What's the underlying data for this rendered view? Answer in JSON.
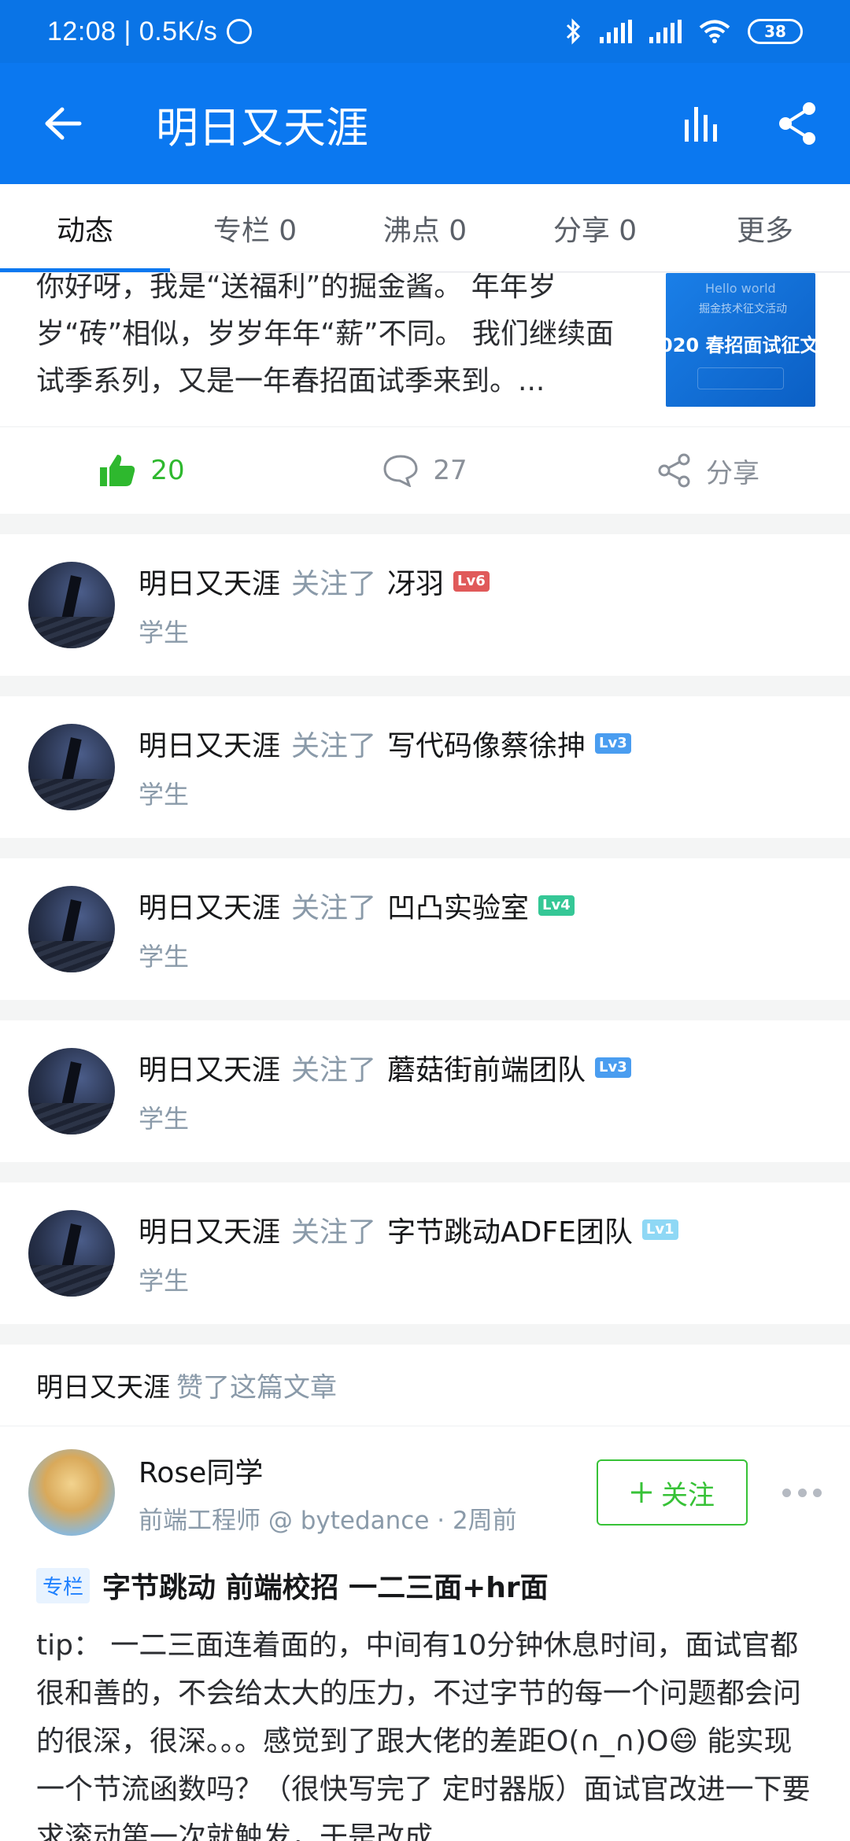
{
  "status_bar": {
    "time": "12:08 | 0.5K/s",
    "battery": "38"
  },
  "app_bar": {
    "title": "明日又天涯"
  },
  "tabs": [
    {
      "label": "动态"
    },
    {
      "label": "专栏 0"
    },
    {
      "label": "沸点 0"
    },
    {
      "label": "分享 0"
    },
    {
      "label": "更多"
    }
  ],
  "top_article": {
    "excerpt": "你好呀，我是“送福利”的掘金酱。 年年岁岁“砖”相似，岁岁年年“薪”不同。 我们继续面试季系列，又是一年春招面试季来到。...",
    "thumb_line1": "Hello world",
    "thumb_line2": "掘金技术征文活动",
    "thumb_line3": "020 春招面试征文",
    "likes": "20",
    "comments": "27",
    "share": "分享"
  },
  "follow_activities": [
    {
      "user": "明日又天涯",
      "action": "关注了",
      "target": "冴羽",
      "level": "Lv6",
      "level_color": "#e05a5a",
      "role": "学生"
    },
    {
      "user": "明日又天涯",
      "action": "关注了",
      "target": "写代码像蔡徐抻",
      "level": "Lv3",
      "level_color": "#4a9df0",
      "role": "学生"
    },
    {
      "user": "明日又天涯",
      "action": "关注了",
      "target": "凹凸实验室",
      "level": "Lv4",
      "level_color": "#35c796",
      "role": "学生"
    },
    {
      "user": "明日又天涯",
      "action": "关注了",
      "target": "蘑菇街前端团队",
      "level": "Lv3",
      "level_color": "#4a9df0",
      "role": "学生"
    },
    {
      "user": "明日又天涯",
      "action": "关注了",
      "target": "字节跳动ADFE团队",
      "level": "Lv1",
      "level_color": "#8fd8f5",
      "role": "学生"
    }
  ],
  "liked_post": {
    "header_user": "明日又天涯",
    "header_action": "赞了这篇文章",
    "author_name": "Rose同学",
    "author_sub": "前端工程师 @ bytedance · 2周前",
    "follow_label": "关注",
    "badge": "专栏",
    "title": "字节跳动 前端校招  一二三面+hr面",
    "body": "tip： 一二三面连着面的，中间有10分钟休息时间，面试官都很和善的，不会给太大的压力，不过字节的每一个问题都会问的很深，很深。。。感觉到了跟大佬的差距O(∩_∩)O😄 能实现一个节流函数吗？（很快写完了 定时器版）面试官改进一下要求滚动第一次就触发，于是改成..."
  },
  "colors": {
    "brand_blue": "#0b78f0",
    "like_green": "#2eb82e",
    "muted": "#8a9aa9"
  }
}
